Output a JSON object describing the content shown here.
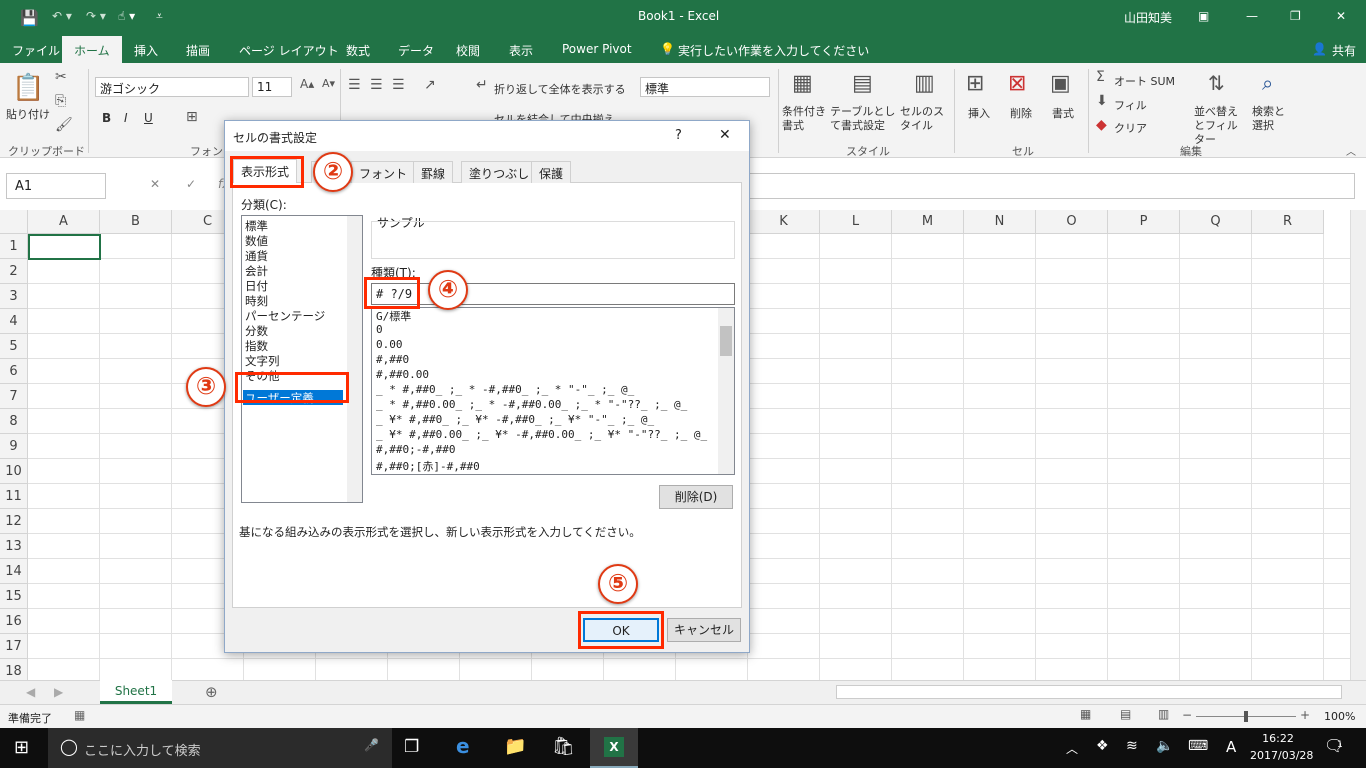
{
  "window": {
    "title": "Book1  -  Excel",
    "user": "山田知美"
  },
  "ribbon_tabs": [
    "ファイル",
    "ホーム",
    "挿入",
    "描画",
    "ページ レイアウト",
    "数式",
    "データ",
    "校閲",
    "表示",
    "Power Pivot",
    "実行したい作業を入力してください",
    "共有"
  ],
  "ribbon": {
    "paste": "貼り付け",
    "clipboard": "クリップボード",
    "font_group": "フォント",
    "font_name": "游ゴシック",
    "font_size": "11",
    "bold": "B",
    "italic": "I",
    "underline": "U",
    "wrap": "折り返して全体を表示する",
    "merge": "セルを結合して中央揃え",
    "number_format": "標準",
    "cond_format": "条件付き書式",
    "table_format": "テーブルとして書式設定",
    "cell_style": "セルのスタイル",
    "style_group": "スタイル",
    "insert": "挿入",
    "delete": "削除",
    "format": "書式",
    "cells_group": "セル",
    "autosum": "オート SUM",
    "fill": "フィル",
    "clear": "クリア",
    "sort": "並べ替えとフィルター",
    "find": "検索と選択",
    "edit_group": "編集"
  },
  "formula_bar": {
    "name_box": "A1"
  },
  "grid": {
    "columns": [
      "A",
      "B",
      "C",
      "D",
      "E",
      "F",
      "G",
      "H",
      "I",
      "J",
      "K",
      "L",
      "M",
      "N",
      "O",
      "P",
      "Q",
      "R"
    ],
    "rows": [
      "1",
      "2",
      "3",
      "4",
      "5",
      "6",
      "7",
      "8",
      "9",
      "10",
      "11",
      "12",
      "13",
      "14",
      "15",
      "16",
      "17",
      "18"
    ]
  },
  "sheet_tab": "Sheet1",
  "status": {
    "ready": "準備完了",
    "zoom": "100%"
  },
  "taskbar": {
    "search": "ここに入力して検索",
    "time": "16:22",
    "date": "2017/03/28",
    "ime": "A",
    "notif": "1"
  },
  "dialog": {
    "title": "セルの書式設定",
    "help": "?",
    "close": "✕",
    "tabs": [
      "表示形式",
      "配置",
      "フォント",
      "罫線",
      "塗りつぶし",
      "保護"
    ],
    "category_label": "分類(C):",
    "categories": [
      "標準",
      "数値",
      "通貨",
      "会計",
      "日付",
      "時刻",
      "パーセンテージ",
      "分数",
      "指数",
      "文字列",
      "その他",
      "ユーザー定義"
    ],
    "sample_label": "サンプル",
    "type_label": "種類(T):",
    "type_value": "# ?/9",
    "formats": [
      "G/標準",
      "0",
      "0.00",
      "#,##0",
      "#,##0.00",
      "_ * #,##0_ ;_ * -#,##0_ ;_ * \"-\"_ ;_ @_",
      "_ * #,##0.00_ ;_ * -#,##0.00_ ;_ * \"-\"??_ ;_ @_",
      "_ ¥* #,##0_ ;_ ¥* -#,##0_ ;_ ¥* \"-\"_ ;_ @_",
      "_ ¥* #,##0.00_ ;_ ¥* -#,##0.00_ ;_ ¥* \"-\"??_ ;_ @_",
      "#,##0;-#,##0",
      "#,##0;[赤]-#,##0"
    ],
    "delete_btn": "削除(D)",
    "description": "基になる組み込みの表示形式を選択し、新しい表示形式を入力してください。",
    "ok": "OK",
    "cancel": "キャンセル"
  },
  "annotations": {
    "step2": "②",
    "step3": "③",
    "step4": "④",
    "step5": "⑤"
  }
}
